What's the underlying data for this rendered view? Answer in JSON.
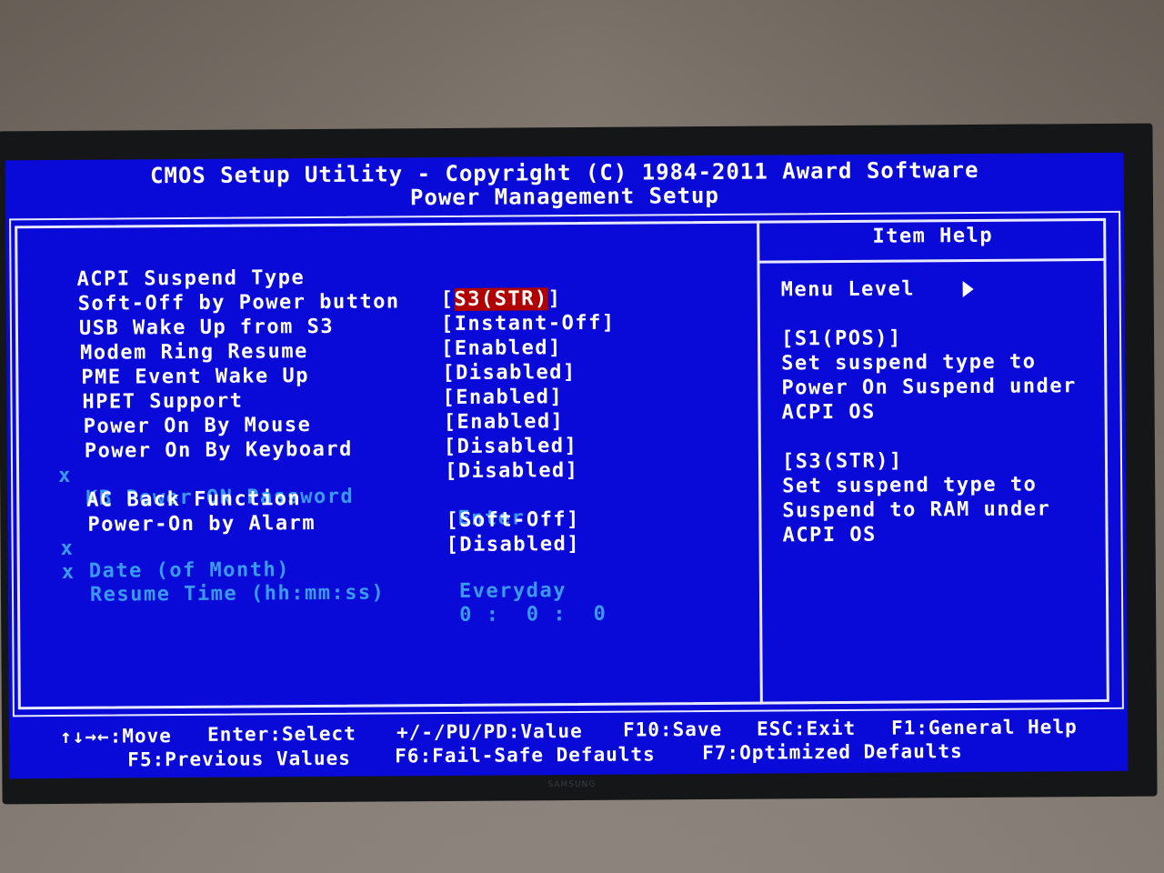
{
  "header": {
    "title": "CMOS Setup Utility - Copyright (C) 1984-2011 Award Software",
    "subtitle": "Power Management Setup"
  },
  "settings": [
    {
      "label": "ACPI Suspend Type",
      "value": "S3(STR)",
      "selected": true,
      "disabled": false
    },
    {
      "label": "Soft-Off by Power button",
      "value": "[Instant-Off]",
      "disabled": false
    },
    {
      "label": "USB Wake Up from S3",
      "value": "[Enabled]",
      "disabled": false
    },
    {
      "label": "Modem Ring Resume",
      "value": "[Disabled]",
      "disabled": false
    },
    {
      "label": "PME Event Wake Up",
      "value": "[Enabled]",
      "disabled": false
    },
    {
      "label": "HPET Support",
      "value": "[Enabled]",
      "disabled": false
    },
    {
      "label": "Power On By Mouse",
      "value": "[Disabled]",
      "disabled": false
    },
    {
      "label": "Power On By Keyboard",
      "value": "[Disabled]",
      "disabled": false
    },
    {
      "label": "KB Power ON Password",
      "value": "Enter",
      "disabled": true,
      "marker": "x"
    },
    {
      "label": "AC Back Function",
      "value": "[Soft-Off]",
      "disabled": false
    },
    {
      "label": "Power-On by Alarm",
      "value": "[Disabled]",
      "disabled": false
    },
    {
      "label": "Date (of Month)",
      "value": "Everyday",
      "disabled": true,
      "marker": "x"
    },
    {
      "label": "Resume Time (hh:mm:ss)",
      "value": "0 :  0 :  0",
      "disabled": true,
      "marker": "x"
    }
  ],
  "help": {
    "title": "Item Help",
    "menu_level": "Menu Level",
    "lines": [
      "[S1(POS)]",
      "Set suspend type to",
      "Power On Suspend under",
      "ACPI OS",
      "",
      "[S3(STR)]",
      "Set suspend type to",
      "Suspend to RAM under",
      "ACPI OS"
    ]
  },
  "footer": {
    "move": "↑↓→←:Move",
    "enter": "Enter:Select",
    "value": "+/-/PU/PD:Value",
    "save": "F10:Save",
    "exit": "ESC:Exit",
    "help": "F1:General Help",
    "prev": "F5:Previous Values",
    "failsafe": "F6:Fail-Safe Defaults",
    "optimized": "F7:Optimized Defaults"
  },
  "monitor": {
    "brand": "SAMSUNG"
  },
  "colors": {
    "screen_bg": "#0a0ad8",
    "text": "#ffffff",
    "disabled_text": "#3a9af0",
    "highlight_bg": "#b00000"
  }
}
